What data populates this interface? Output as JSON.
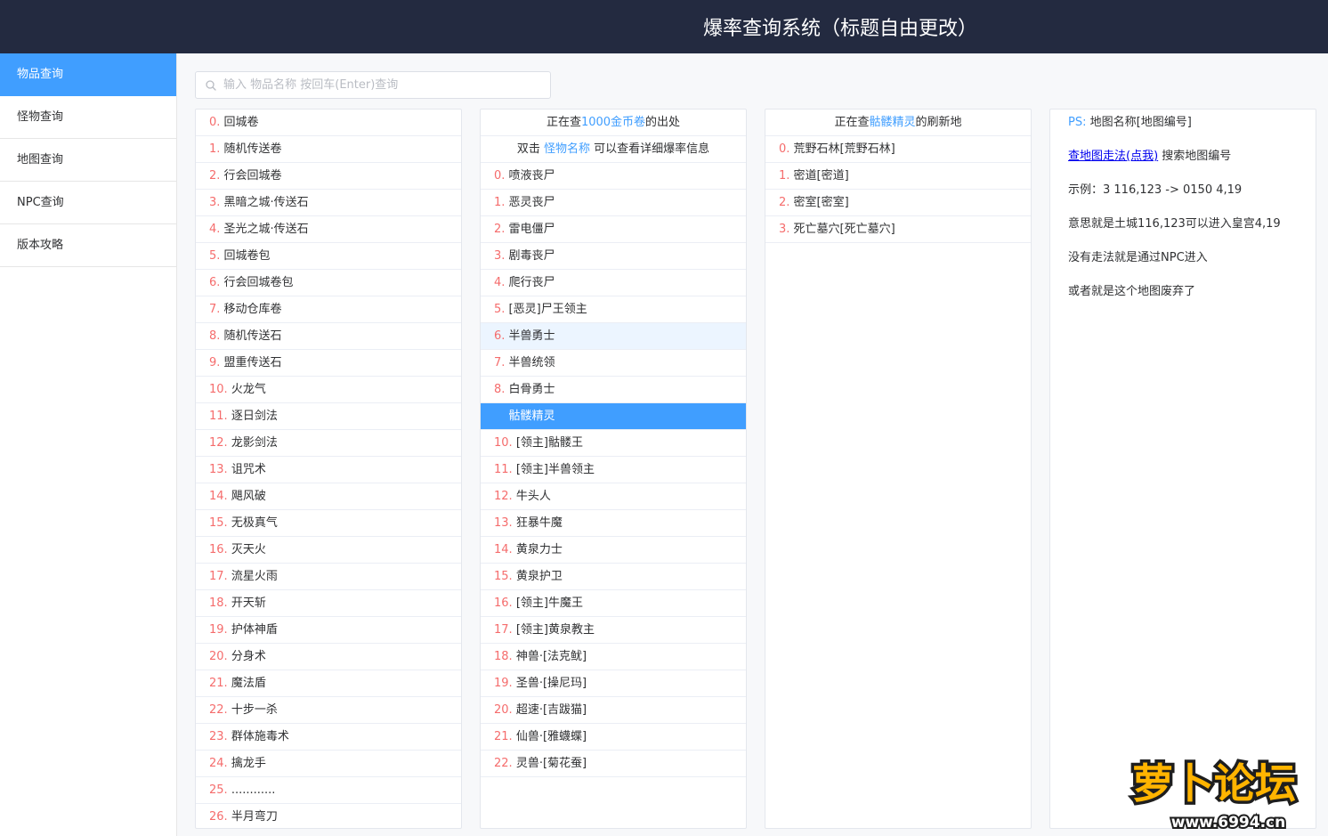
{
  "app": {
    "title": "爆率查询系统（标题自由更改）"
  },
  "sidebar": {
    "items": [
      {
        "label": "物品查询",
        "active": true
      },
      {
        "label": "怪物查询",
        "active": false
      },
      {
        "label": "地图查询",
        "active": false
      },
      {
        "label": "NPC查询",
        "active": false
      },
      {
        "label": "版本攻略",
        "active": false
      }
    ]
  },
  "search": {
    "placeholder": "输入 物品名称 按回车(Enter)查询",
    "value": ""
  },
  "items": [
    "回城卷",
    "随机传送卷",
    "行会回城卷",
    "黑暗之城·传送石",
    "圣光之城·传送石",
    "回城卷包",
    "行会回城卷包",
    "移动仓库卷",
    "随机传送石",
    "盟重传送石",
    "火龙气",
    "逐日剑法",
    "龙影剑法",
    "诅咒术",
    "飓风破",
    "无极真气",
    "灭天火",
    "流星火雨",
    "开天斩",
    "护体神盾",
    "分身术",
    "魔法盾",
    "十步一杀",
    "群体施毒术",
    "擒龙手",
    "............",
    "半月弯刀"
  ],
  "monsters": {
    "header": {
      "prefix": "正在查",
      "item": "1000金币卷",
      "suffix": "的出处"
    },
    "hint": {
      "prefix": "双击 ",
      "link": "怪物名称",
      "suffix": " 可以查看详细爆率信息"
    },
    "list": [
      "喷液丧尸",
      "恶灵丧尸",
      "雷电僵尸",
      "剧毒丧尸",
      "爬行丧尸",
      "[恶灵]尸王领主",
      "半兽勇士",
      "半兽统领",
      "白骨勇士",
      "骷髅精灵",
      "[领主]骷髅王",
      "[领主]半兽领主",
      "牛头人",
      "狂暴牛魔",
      "黄泉力士",
      "黄泉护卫",
      "[领主]牛魔王",
      "[领主]黄泉教主",
      "神兽·[法克鱿]",
      "圣兽·[操尼玛]",
      "超速·[吉跋猫]",
      "仙兽·[雅蠛蝶]",
      "灵兽·[菊花蚕]"
    ],
    "hover_index": 6,
    "selected_index": 9
  },
  "maps": {
    "header": {
      "prefix": "正在查",
      "monster": "骷髅精灵",
      "suffix": "的刷新地"
    },
    "list": [
      "荒野石林[荒野石林]",
      "密道[密道]",
      "密室[密室]",
      "死亡墓穴[死亡墓穴]"
    ]
  },
  "info": {
    "ps_label": "PS:",
    "ps_text": " 地图名称[地图编号]",
    "link_text": "查地图走法(点我)",
    "link_suffix": " 搜索地图编号",
    "example": "示例：3 116,123 -> 0150 4,19",
    "meaning": "意思就是土城116,123可以进入皇宫4,19",
    "no_route": "没有走法就是通过NPC进入",
    "abandoned": "或者就是这个地图废弃了"
  },
  "watermark": {
    "text": "萝卜论坛",
    "url": "www.6994.cn"
  },
  "colors": {
    "header_bg": "#232a40",
    "accent": "#409eff",
    "index_red": "#f56c6c",
    "hover_bg": "#ecf5ff",
    "main_bg": "#f7f8fa"
  }
}
